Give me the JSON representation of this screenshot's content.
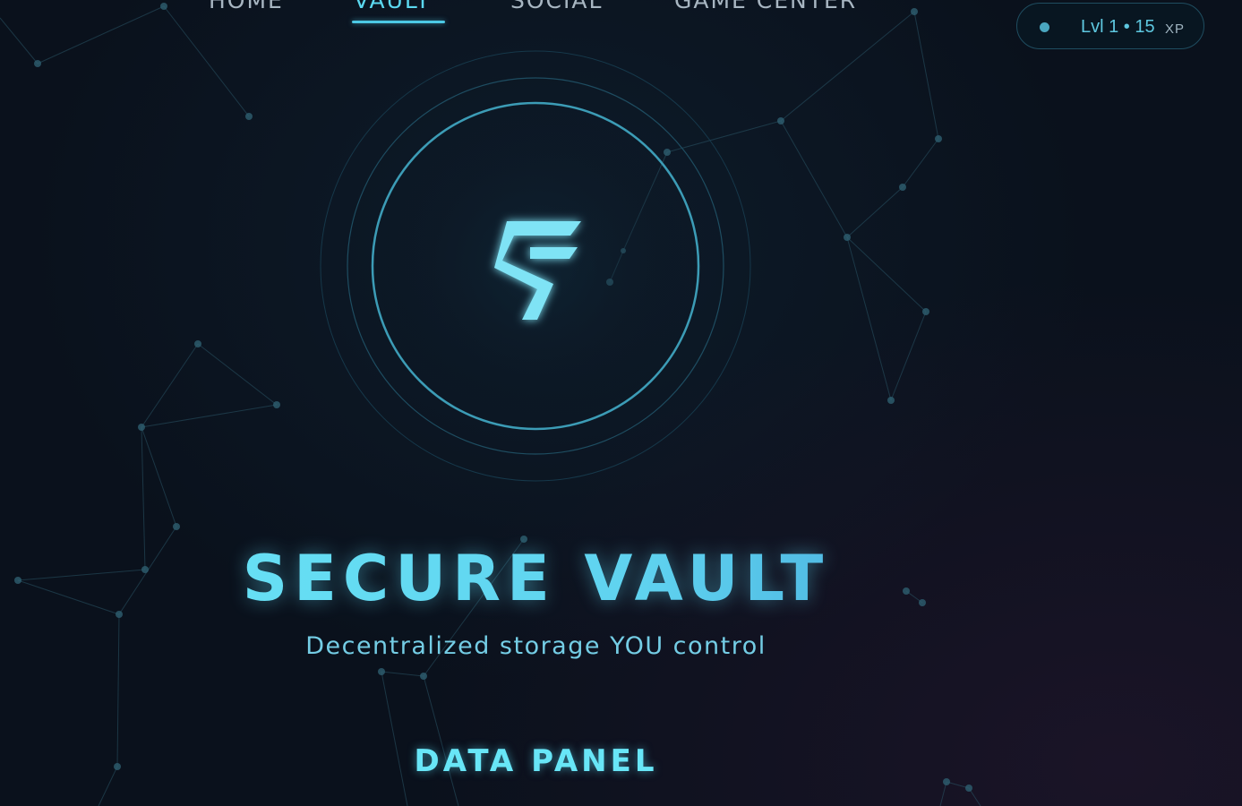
{
  "nav": {
    "items": [
      {
        "label": "HOME"
      },
      {
        "label": "VAULT",
        "active": true
      },
      {
        "label": "SOCIAL"
      },
      {
        "label": "GAME CENTER"
      }
    ]
  },
  "xp": {
    "level_text": "Lvl 1 • 15",
    "unit": "XP",
    "dot_color": "#4aa6bf"
  },
  "vault": {
    "logo_icon": "vault-s-logo-icon",
    "title": "SECURE VAULT",
    "subtitle": "Decentralized storage YOU control"
  },
  "sections": {
    "data_panel": "DATA PANEL"
  },
  "colors": {
    "accent": "#5bd8f0",
    "ring": "#3a9ab3",
    "background": "#0a111c"
  }
}
